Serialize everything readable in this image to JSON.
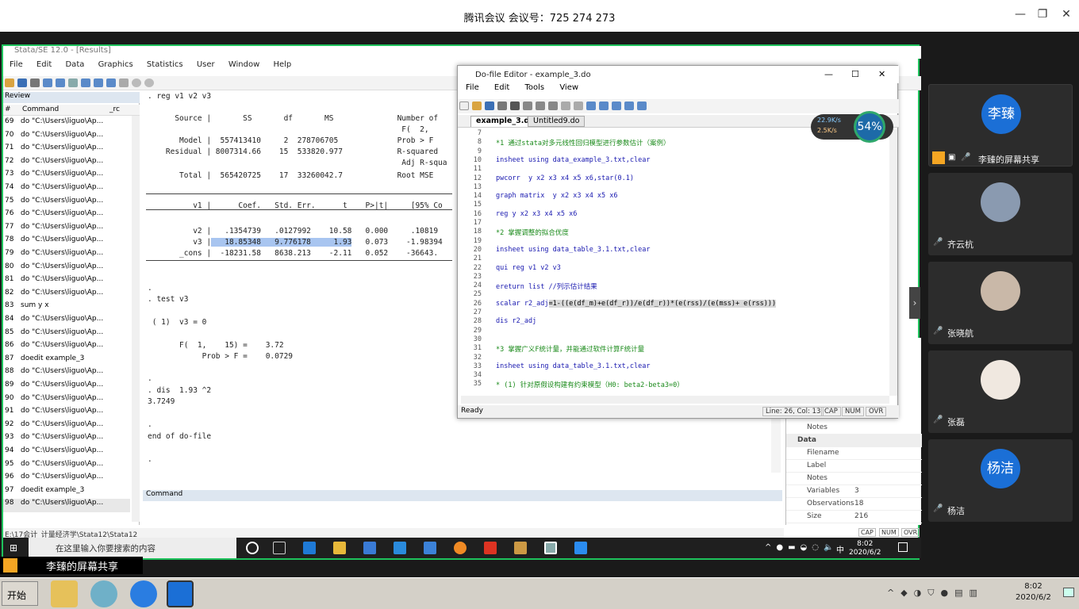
{
  "meeting": {
    "title": "腾讯会议 会议号：725 274 273"
  },
  "stata": {
    "title": "Stata/SE 12.0 - [Results]",
    "menu": [
      "File",
      "Edit",
      "Data",
      "Graphics",
      "Statistics",
      "User",
      "Window",
      "Help"
    ],
    "review": {
      "header": "Review",
      "col_num": "#",
      "col_cmd": "Command",
      "col_rc": "_rc",
      "rows": [
        [
          "69",
          "do \"C:\\Users\\liguo\\Ap..."
        ],
        [
          "70",
          "do \"C:\\Users\\liguo\\Ap..."
        ],
        [
          "71",
          "do \"C:\\Users\\liguo\\Ap..."
        ],
        [
          "72",
          "do \"C:\\Users\\liguo\\Ap..."
        ],
        [
          "73",
          "do \"C:\\Users\\liguo\\Ap..."
        ],
        [
          "74",
          "do \"C:\\Users\\liguo\\Ap..."
        ],
        [
          "75",
          "do \"C:\\Users\\liguo\\Ap..."
        ],
        [
          "76",
          "do \"C:\\Users\\liguo\\Ap..."
        ],
        [
          "77",
          "do \"C:\\Users\\liguo\\Ap..."
        ],
        [
          "78",
          "do \"C:\\Users\\liguo\\Ap..."
        ],
        [
          "79",
          "do \"C:\\Users\\liguo\\Ap..."
        ],
        [
          "80",
          "do \"C:\\Users\\liguo\\Ap..."
        ],
        [
          "81",
          "do \"C:\\Users\\liguo\\Ap..."
        ],
        [
          "82",
          "do \"C:\\Users\\liguo\\Ap..."
        ],
        [
          "83",
          "sum y x"
        ],
        [
          "84",
          "do \"C:\\Users\\liguo\\Ap..."
        ],
        [
          "85",
          "do \"C:\\Users\\liguo\\Ap..."
        ],
        [
          "86",
          "do \"C:\\Users\\liguo\\Ap..."
        ],
        [
          "87",
          "doedit example_3"
        ],
        [
          "88",
          "do \"C:\\Users\\liguo\\Ap..."
        ],
        [
          "89",
          "do \"C:\\Users\\liguo\\Ap..."
        ],
        [
          "90",
          "do \"C:\\Users\\liguo\\Ap..."
        ],
        [
          "91",
          "do \"C:\\Users\\liguo\\Ap..."
        ],
        [
          "92",
          "do \"C:\\Users\\liguo\\Ap..."
        ],
        [
          "93",
          "do \"C:\\Users\\liguo\\Ap..."
        ],
        [
          "94",
          "do \"C:\\Users\\liguo\\Ap..."
        ],
        [
          "95",
          "do \"C:\\Users\\liguo\\Ap..."
        ],
        [
          "96",
          "do \"C:\\Users\\liguo\\Ap..."
        ],
        [
          "97",
          "doedit example_3"
        ],
        [
          "98",
          "do \"C:\\Users\\liguo\\Ap..."
        ]
      ]
    },
    "results": {
      "l1": ". reg v1 v2 v3",
      "l2": "      Source |       SS       df       MS              Number of",
      "l3": "                                                        F(  2,",
      "l4": "       Model |  557413410     2  278706705             Prob > F",
      "l5": "    Residual | 8007314.66    15  533820.977            R-squared",
      "l6": "                                                        Adj R-squa",
      "l7": "       Total |  565420725    17  33260042.7            Root MSE",
      "l8": "          v1 |      Coef.   Std. Err.      t    P>|t|     [95% Co",
      "l9": "          v2 |   .1354739   .0127992    10.58   0.000     .10819",
      "l10a": "          v3 |",
      "l10b": "   18.85348   9.776178     1.93",
      "l10c": "   0.073    -1.98394",
      "l11": "       _cons |  -18231.58   8638.213    -2.11   0.052    -36643.",
      "l12": ".",
      "l13": ". test v3",
      "l14": " ( 1)  v3 = 0",
      "l15": "       F(  1,    15) =    3.72",
      "l16": "            Prob > F =    0.0729",
      "l17": ".",
      "l18": ". dis  1.93 ^2",
      "l19": "3.7249",
      "l20": ".",
      "l21": "end of do-file",
      "l22": "."
    },
    "command_label": "Command",
    "status_path": "E:\\17会计_计量经济学\\Stata12\\Stata12",
    "status_caps": [
      "CAP",
      "NUM",
      "OVR"
    ],
    "props": {
      "notes1": "Notes",
      "data": "Data",
      "filename": "Filename",
      "label": "Label",
      "notes2": "Notes",
      "variables": "Variables",
      "variables_val": "3",
      "observations": "Observations",
      "observations_val": "18",
      "size": "Size",
      "size_val": "216"
    }
  },
  "doedit": {
    "title": "Do-file Editor - example_3.do",
    "menu": [
      "File",
      "Edit",
      "Tools",
      "View"
    ],
    "tabs": [
      "example_3.do",
      "Untitled9.do"
    ],
    "lines": [
      [
        "7",
        ""
      ],
      [
        "8",
        "*1 通过stata对多元线性回归模型进行参数估计（案例）"
      ],
      [
        "9",
        ""
      ],
      [
        "10",
        "insheet using data_example_3.txt,clear"
      ],
      [
        "11",
        ""
      ],
      [
        "12",
        "pwcorr  y x2 x3 x4 x5 x6,star(0.1)"
      ],
      [
        "13",
        ""
      ],
      [
        "14",
        "graph matrix  y x2 x3 x4 x5 x6"
      ],
      [
        "15",
        ""
      ],
      [
        "16",
        "reg y x2 x3 x4 x5 x6"
      ],
      [
        "17",
        ""
      ],
      [
        "18",
        "*2 掌握调整的拟合优度"
      ],
      [
        "19",
        ""
      ],
      [
        "20",
        "insheet using data_table_3.1.txt,clear"
      ],
      [
        "21",
        ""
      ],
      [
        "22",
        "qui reg v1 v2 v3"
      ],
      [
        "23",
        ""
      ],
      [
        "24",
        "ereturn list //列示估计结果"
      ],
      [
        "25",
        ""
      ],
      [
        "26a",
        "scalar r2_adj"
      ],
      [
        "26b",
        "=1-((e(df_m)+e(df_r))/e(df_r))*(e(rss)/(e(mss)+ e(rss)))"
      ],
      [
        "27",
        ""
      ],
      [
        "28",
        "dis r2_adj"
      ],
      [
        "29",
        ""
      ],
      [
        "30",
        ""
      ],
      [
        "31",
        "*3 掌握广义F统计量，并能通过软件计算F统计量"
      ],
      [
        "32",
        ""
      ],
      [
        "33",
        "insheet using data_table_3.1.txt,clear"
      ],
      [
        "34",
        ""
      ],
      [
        "35",
        "* (1) 针对原假设构建有约束模型（H0: beta2-beta3=0）"
      ]
    ],
    "status_ready": "Ready",
    "status_pos": "Line: 26, Col: 13",
    "status_caps": [
      "CAP",
      "NUM",
      "OVR"
    ]
  },
  "netspeed": {
    "up": "22.9K/s",
    "down": "2.5K/s",
    "pct": "54%"
  },
  "wintask": {
    "search_placeholder": "在这里输入你要搜索的内容",
    "time": "8:02",
    "date": "2020/6/2",
    "ime": "中"
  },
  "participants": [
    {
      "name": "李臻的屏幕共享",
      "initials": "李臻",
      "color": "#1b6fd6"
    },
    {
      "name": "齐云杭",
      "initials": "",
      "color": "#8a9ab0"
    },
    {
      "name": "张晓航",
      "initials": "",
      "color": "#c9b8a8"
    },
    {
      "name": "张磊",
      "initials": "",
      "color": "#f0e8e0"
    },
    {
      "name": "杨洁",
      "initials": "杨洁",
      "color": "#1b6fd6"
    }
  ],
  "share_label": "李臻的屏幕共享",
  "xp": {
    "start": "开始",
    "time": "8:02",
    "date": "2020/6/2"
  }
}
